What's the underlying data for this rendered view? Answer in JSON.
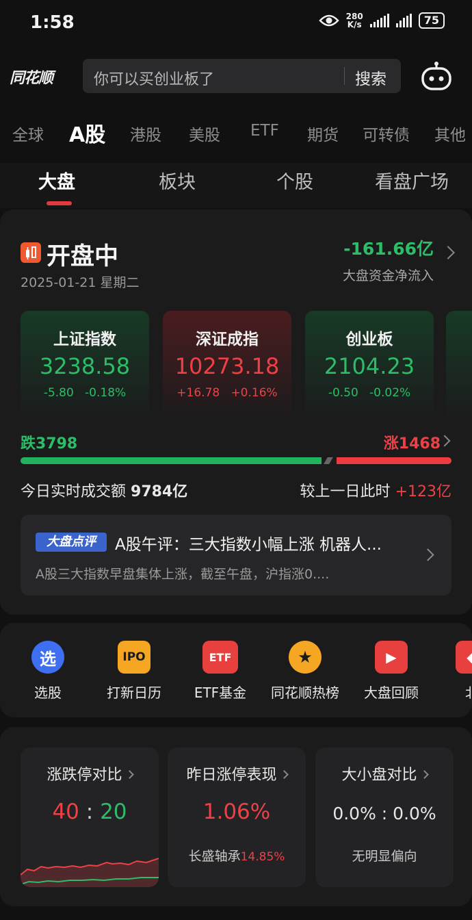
{
  "status_bar": {
    "time": "1:58",
    "net_speed_value": "280",
    "net_speed_unit": "K/s",
    "battery": "75"
  },
  "header": {
    "logo": "同花顺",
    "search_placeholder": "你可以买创业板了",
    "search_button": "搜索"
  },
  "market_tabs": [
    "全球",
    "A股",
    "港股",
    "美股",
    "ETF",
    "期货",
    "可转债",
    "其他"
  ],
  "market_tab_active": "A股",
  "sub_tabs": [
    "大盘",
    "板块",
    "个股",
    "看盘广场"
  ],
  "sub_tab_active": "大盘",
  "market_status": {
    "title": "开盘中",
    "date": "2025-01-21 星期二",
    "net_flow_value": "-161.66亿",
    "net_flow_label": "大盘资金净流入"
  },
  "indices": [
    {
      "name": "上证指数",
      "value": "3238.58",
      "change": "-5.80",
      "pct": "-0.18%",
      "trend": "down"
    },
    {
      "name": "深证成指",
      "value": "10273.18",
      "change": "+16.78",
      "pct": "+0.16%",
      "trend": "up"
    },
    {
      "name": "创业板",
      "value": "2104.23",
      "change": "-0.50",
      "pct": "-0.02%",
      "trend": "down"
    }
  ],
  "breadth": {
    "fall_label": "跌3798",
    "rise_label": "涨1468",
    "fall_count": 3798,
    "rise_count": 1468
  },
  "volume": {
    "label": "今日实时成交额",
    "value": "9784亿",
    "compare_label": "较上一日此时",
    "compare_value": "+123亿"
  },
  "review": {
    "badge": "大盘点评",
    "title": "A股午评：三大指数小幅上涨 机器人...",
    "summary": "A股三大指数早盘集体上涨，截至午盘，沪指涨0...."
  },
  "quick_entries": [
    {
      "label": "选股",
      "icon": "select-stock-icon",
      "glyph": "选"
    },
    {
      "label": "打新日历",
      "icon": "ipo-calendar-icon",
      "glyph": "IPO"
    },
    {
      "label": "ETF基金",
      "icon": "etf-icon",
      "glyph": "ETF"
    },
    {
      "label": "同花顺热榜",
      "icon": "hot-list-icon",
      "glyph": "★"
    },
    {
      "label": "大盘回顾",
      "icon": "market-replay-icon",
      "glyph": "▶"
    },
    {
      "label": "北",
      "icon": "north-fund-icon",
      "glyph": "◆"
    }
  ],
  "mini_cards": {
    "limit_compare": {
      "title": "涨跌停对比",
      "up": "40",
      "sep": ":",
      "down": "20"
    },
    "yesterday_limit": {
      "title": "昨日涨停表现",
      "value": "1.06%",
      "stock": "长盛轴承",
      "stock_pct": "14.85%"
    },
    "size_compare": {
      "title": "大小盘对比",
      "value": "0.0% : 0.0%",
      "note": "无明显偏向"
    }
  },
  "colors": {
    "up": "#ef4046",
    "down": "#2dbd68",
    "accent": "#e03a3e",
    "badge": "#3a63cc"
  }
}
